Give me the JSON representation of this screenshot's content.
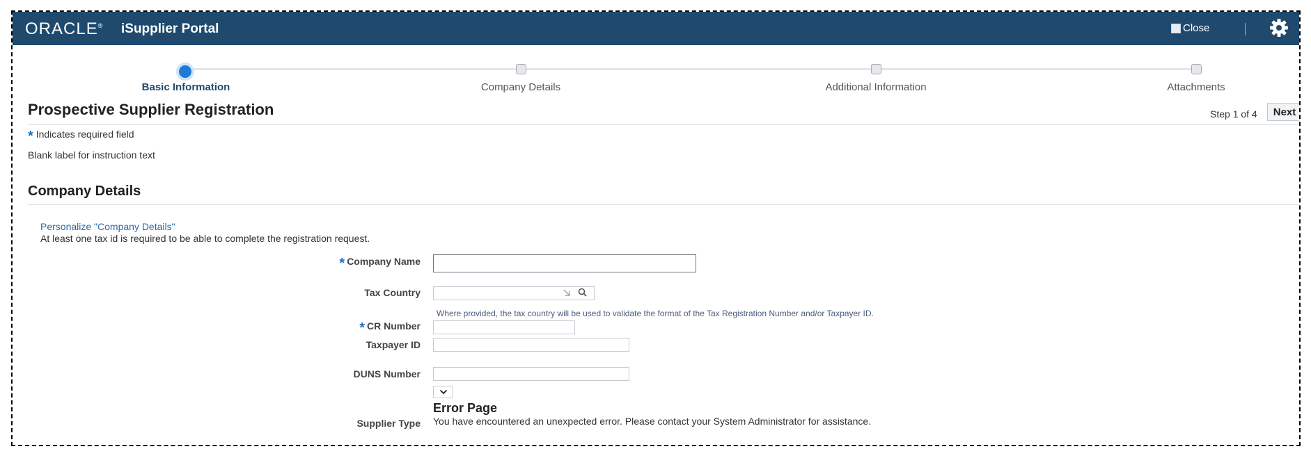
{
  "header": {
    "logo_text": "ORACLE",
    "portal_title": "iSupplier Portal",
    "close_label": "Close"
  },
  "train": {
    "steps": [
      {
        "label": "Basic Information",
        "active": true
      },
      {
        "label": "Company Details",
        "active": false
      },
      {
        "label": "Additional Information",
        "active": false
      },
      {
        "label": "Attachments",
        "active": false
      }
    ]
  },
  "page": {
    "title": "Prospective Supplier Registration",
    "step_text": "Step 1 of 4",
    "next_label": "Next",
    "required_note": "Indicates required field",
    "instruction_text": "Blank label for instruction text"
  },
  "section": {
    "title": "Company Details",
    "personalize_link": "Personalize \"Company Details\"",
    "tax_note": "At least one tax id is required to be able to complete the registration request."
  },
  "fields": {
    "company_name": {
      "label": "Company Name",
      "value": ""
    },
    "tax_country": {
      "label": "Tax Country",
      "value": "",
      "hint": "Where provided, the tax country will be used to validate the format of the Tax Registration Number and/or Taxpayer ID."
    },
    "cr_number": {
      "label": "CR Number",
      "value": ""
    },
    "taxpayer_id": {
      "label": "Taxpayer ID",
      "value": ""
    },
    "duns_number": {
      "label": "DUNS Number",
      "value": ""
    },
    "supplier_type": {
      "label": "Supplier Type"
    }
  },
  "error": {
    "title": "Error Page",
    "message": "You have encountered an unexpected error. Please contact your System Administrator for assistance."
  },
  "colors": {
    "header_bg": "#1f4a6e",
    "accent_blue": "#1e7ad6",
    "link": "#2b6aa6"
  },
  "icons": [
    "gear-icon",
    "search-icon",
    "lov-arrow-icon",
    "chevron-down-icon",
    "broken-image-icon"
  ]
}
